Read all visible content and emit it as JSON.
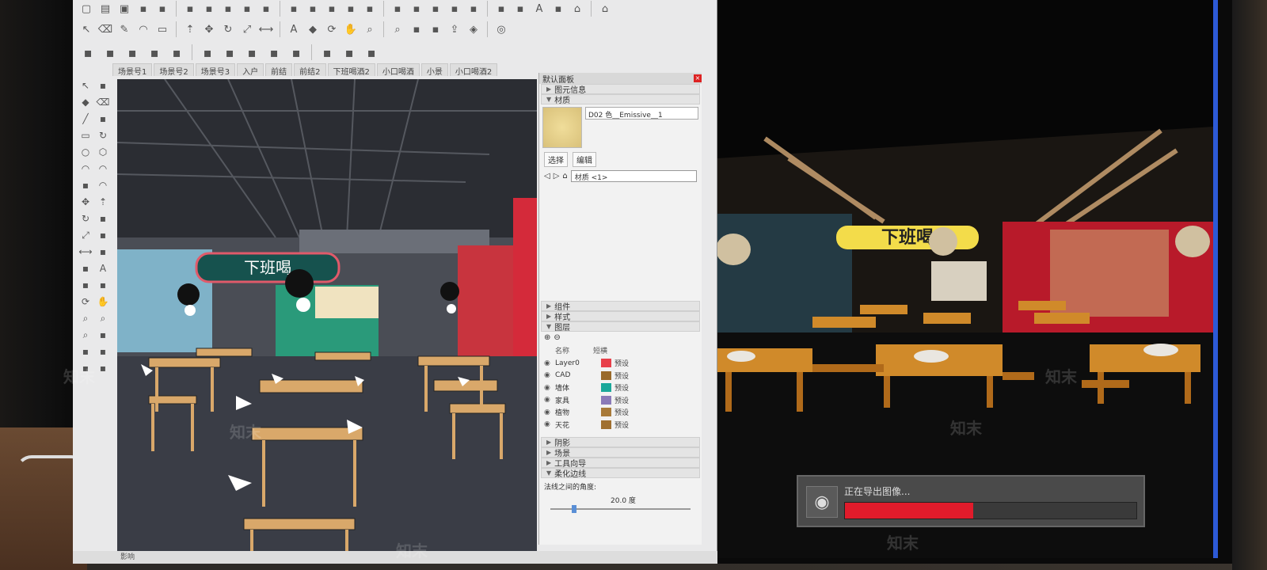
{
  "toolbar": {
    "row1_icons": [
      "new-icon",
      "open-icon",
      "save-icon",
      "cut-icon",
      "copy-icon",
      "paste-icon",
      "erase-icon",
      "undo-icon",
      "redo-icon",
      "print-icon",
      "model-info-icon",
      "iso-view-icon",
      "top-view-icon",
      "front-view-icon",
      "right-view-icon",
      "back-view-icon",
      "left-view-icon",
      "bottom-view-icon",
      "xray-icon",
      "wireframe-icon",
      "hidden-line-icon",
      "shaded-icon",
      "textured-icon",
      "monochrome-icon",
      "house-icon",
      "house-front-icon"
    ],
    "row2_icons": [
      "select-icon",
      "eraser-icon",
      "pencil-icon",
      "arc-icon",
      "rectangle-icon",
      "push-pull-icon",
      "move-icon",
      "rotate-icon",
      "scale-icon",
      "tape-icon",
      "text-icon",
      "paint-icon",
      "orbit-icon",
      "pan-icon",
      "zoom-icon",
      "zoom-extents-icon",
      "warehouse-icon",
      "extension-icon",
      "share-icon",
      "ruby-icon",
      "profile-icon"
    ],
    "row3_icons": [
      "vray-render-icon",
      "vray-interactive-icon",
      "vray-lights-icon",
      "vray-camera-icon",
      "vray-frame-icon",
      "vray-asset-icon",
      "vray-proxy-icon",
      "vray-fur-icon",
      "vray-settings-icon",
      "vray-sound-icon",
      "vray-batch-icon",
      "vray-chat-icon",
      "vray-info-icon"
    ]
  },
  "scene_tabs": [
    "场景号1",
    "场景号2",
    "场景号3",
    "入户",
    "前结",
    "前结2",
    "下班喝酒2",
    "小口喝酒",
    "小景",
    "小口喝酒2"
  ],
  "left_tools": [
    "select-icon",
    "component-icon",
    "paint-icon",
    "eraser-icon",
    "line-icon",
    "freehand-icon",
    "rectangle-icon",
    "rotated-rect-icon",
    "circle-icon",
    "polygon-icon",
    "arc-icon",
    "arc2-icon",
    "pie-icon",
    "arc3-icon",
    "move-icon",
    "push-pull-icon",
    "rotate-icon",
    "follow-me-icon",
    "scale-icon",
    "offset-icon",
    "tape-icon",
    "dimension-icon",
    "protractor-icon",
    "text-icon",
    "axes-icon",
    "3d-text-icon",
    "orbit-icon",
    "pan-icon",
    "zoom-icon",
    "zoom-window-icon",
    "zoom-extents-icon",
    "prev-icon",
    "position-camera-icon",
    "look-around-icon",
    "walk-icon",
    "section-icon"
  ],
  "tray": {
    "title": "默认面板",
    "entity_info": "图元信息",
    "materials": "材质",
    "material_name": "D02 色__Emissive__1",
    "tab_select": "选择",
    "tab_edit": "编辑",
    "library": "材质 <1>",
    "components": "组件",
    "styles": "样式",
    "layers": "图层",
    "layer_col_name": "名称",
    "layer_col_dash": "短横",
    "layers_list": [
      {
        "name": "Layer0",
        "color": "#e8404a",
        "dash": "预设"
      },
      {
        "name": "CAD",
        "color": "#9a6a2a",
        "dash": "预设"
      },
      {
        "name": "墙体",
        "color": "#1aa89a",
        "dash": "预设"
      },
      {
        "name": "家具",
        "color": "#8a7ab8",
        "dash": "预设"
      },
      {
        "name": "植物",
        "color": "#a87a3a",
        "dash": "预设"
      },
      {
        "name": "天花",
        "color": "#a07030",
        "dash": "预设"
      }
    ],
    "shadows": "阴影",
    "scenes": "场景",
    "instructor": "工具向导",
    "soften": "柔化边线",
    "angle_label": "法线之间的角度:",
    "angle_value": "20.0 度",
    "angle_fraction": 0.15
  },
  "status": {
    "text": "影响"
  },
  "render": {
    "sign_text": "下班喝",
    "export_text": "正在导出图像...",
    "export_progress": 0.44
  },
  "viewport": {
    "sign_text": "下班喝"
  },
  "watermark": "知末"
}
